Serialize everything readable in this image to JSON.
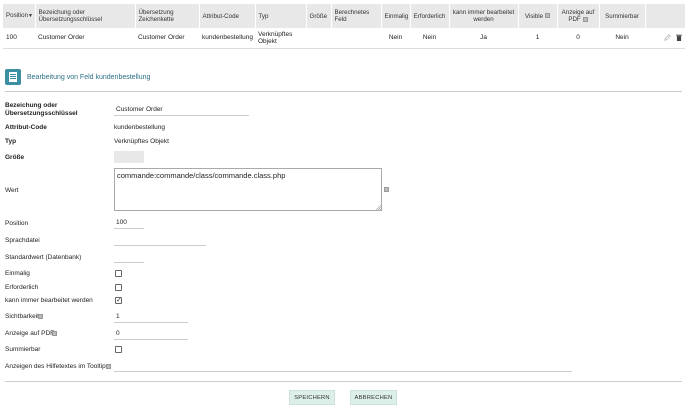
{
  "table": {
    "headers": {
      "position": "Position",
      "label": "Bezeichung oder Übersetzungsschlüssel",
      "translated": "Übersetzung Zeichenkette",
      "attr_code": "Attribut-Code",
      "type": "Typ",
      "size": "Größe",
      "computed": "Berechnetes Feld",
      "unique": "Einmalig",
      "required": "Erforderlich",
      "always_edit": "kann immer bearbeitet werden",
      "visible": "Visible",
      "pdf": "Anzeige auf PDF",
      "summable": "Summierbar"
    },
    "row": {
      "position": "100",
      "label": "Customer Order",
      "translated": "Customer Order",
      "attr_code": "kundenbestellung",
      "type": "Verknüpftes Objekt",
      "size": "",
      "computed": "",
      "unique": "Nein",
      "required": "Nein",
      "always_edit": "Ja",
      "visible": "1",
      "pdf": "0",
      "summable": "Nein"
    }
  },
  "section": {
    "title": "Bearbeitung von Feld kundenbestellung"
  },
  "form": {
    "label_field": {
      "label": "Bezeichung oder Übersetzungsschlüssel",
      "value": "Customer Order"
    },
    "attr_code": {
      "label": "Attribut-Code",
      "value": "kundenbestellung"
    },
    "type": {
      "label": "Typ",
      "value": "Verknüpftes Objekt"
    },
    "size": {
      "label": "Größe",
      "value": ""
    },
    "wert": {
      "label": "Wert",
      "value": "commande:commande/class/commande.class.php"
    },
    "position": {
      "label": "Position",
      "value": "100"
    },
    "langfile": {
      "label": "Sprachdatei",
      "value": ""
    },
    "default": {
      "label": "Standardwert (Datenbank)",
      "value": ""
    },
    "unique": {
      "label": "Einmalig",
      "checked": false
    },
    "required": {
      "label": "Erforderlich",
      "checked": false
    },
    "always_edit": {
      "label": "kann immer bearbeitet werden",
      "checked": true
    },
    "visibility": {
      "label": "Sichtbarkeit",
      "value": "1"
    },
    "pdf": {
      "label": "Anzeige auf PDF",
      "value": "0"
    },
    "summable": {
      "label": "Summierbar",
      "checked": false
    },
    "tooltip": {
      "label": "Anzeigen des Hilfetextes im Tooltip",
      "value": ""
    }
  },
  "buttons": {
    "save": "SPEICHERN",
    "cancel": "ABBRECHEN"
  },
  "colors": {
    "accent": "#3d8fa3",
    "button_bg": "#dcefe8",
    "header_bg": "#e8e8e8"
  }
}
